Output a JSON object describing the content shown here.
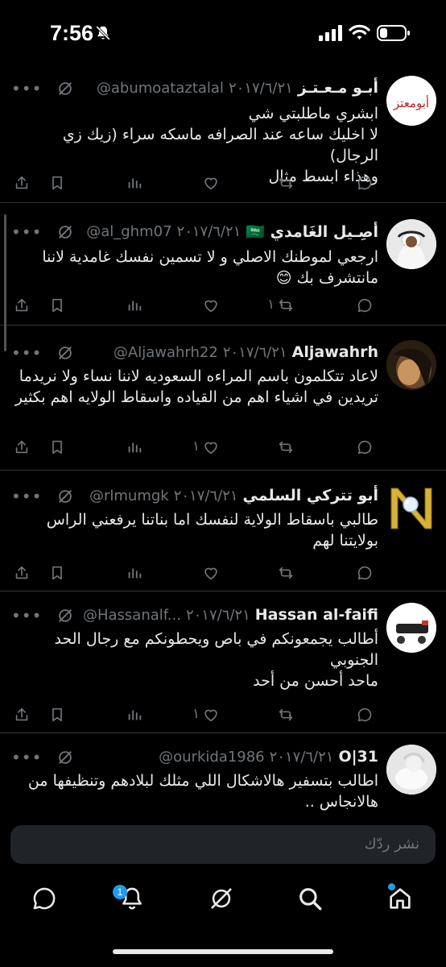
{
  "status_bar": {
    "time": "7:56"
  },
  "tweets": [
    {
      "name": "أبـو مـعـتـز",
      "handle": "@abumoataztalal",
      "date": "٢٠١٧/٦/٢١",
      "text": "ابشري ماطلبتي شي\nلا اخليك ساعه عند الصرافه ماسكه سراء (زيك زي الرجال)\nوهذاء ابسط مثال",
      "retweets": "",
      "likes": "",
      "avatar_text": "أبومعتز"
    },
    {
      "name": "أصِـيل الغَامدي 🇸🇦",
      "handle": "@al_ghm07",
      "date": "٢٠١٧/٦/٢١",
      "text": "ارجعي لموطنك الاصلي و لا تسمين نفسك غامدية لاننا مانتشرف بك 😊",
      "retweets": "١",
      "likes": ""
    },
    {
      "name": "Aljawahrh",
      "handle": "@Aljawahrh22",
      "date": "٢٠١٧/٦/٢١",
      "text": "لاعاد تتكلمون باسم المراءه السعوديه لاننا نساء ولا نريدما تريدين في اشياء اهم من القياده واسقاط الولايه  اهم بكثير",
      "retweets": "",
      "likes": "١"
    },
    {
      "name": "أبو تتركي السلمي",
      "handle": "@rlmumgk",
      "date": "٢٠١٧/٦/٢١",
      "text": "طالبي باسقاط الولاية لنفسك اما بناتنا يرفعني الراس بولايتنا لهم",
      "retweets": "",
      "likes": ""
    },
    {
      "name": "Hassan al-faifi",
      "handle": "@Hassanalf...",
      "date": "٢٠١٧/٦/٢١",
      "text": "أطالب يجمعونكم في باص ويحطونكم مع رجال الحد الجنوبي\nماحد أحسن من أحد",
      "retweets": "",
      "likes": "١"
    },
    {
      "name": "O|31",
      "handle": "@ourkida1986",
      "date": "٢٠١٧/٦/٢١",
      "text": "اطالب بتسفير هالاشكال اللي مثلك لبلادهم وتنظيفها من هالانجاس ..",
      "retweets": "",
      "likes": ""
    }
  ],
  "reply": {
    "placeholder": "نشر ردّك"
  },
  "tabs": {
    "notifications_badge": "1"
  },
  "icons": [
    "bell-off-icon",
    "signal-icon",
    "wifi-icon",
    "battery-icon",
    "more-icon",
    "grok-icon",
    "reply-icon",
    "retweet-icon",
    "like-icon",
    "views-icon",
    "bookmark-icon",
    "share-icon",
    "home-icon",
    "search-icon",
    "notifications-icon",
    "messages-icon"
  ],
  "colors": {
    "background": "#000000",
    "text": "#e7e9ea",
    "muted": "#71767b",
    "accent": "#1d9bf0",
    "divider": "#2f3336"
  }
}
